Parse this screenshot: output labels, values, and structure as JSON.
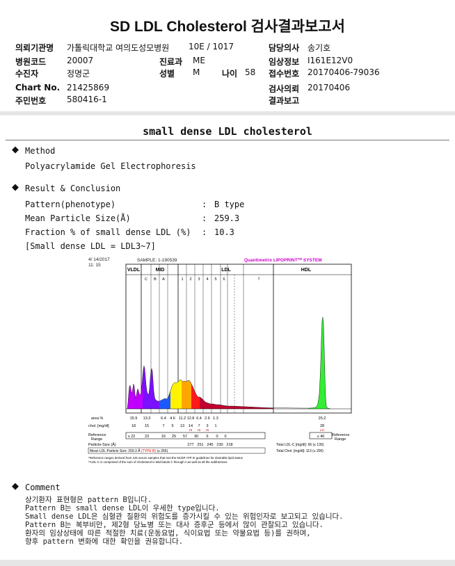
{
  "report_title": "SD LDL Cholesterol 검사결과보고서",
  "header": {
    "institution_label": "의뢰기관명",
    "institution_value": "가톨릭대학교 여의도성모병원",
    "ward_value": "10E / 1017",
    "doctor_label": "담당의사",
    "doctor_value": "송기호",
    "hospital_code_label": "병원코드",
    "hospital_code_value": "20007",
    "dept_label": "진료과",
    "dept_value": "ME",
    "clinical_label": "임상정보",
    "clinical_value": "I161E12V0",
    "patient_label": "수진자",
    "patient_value": "정명군",
    "sex_label": "성별",
    "sex_value": "M",
    "age_label": "나이",
    "age_value": "58",
    "receipt_label": "접수번호",
    "receipt_value": "20170406-79036",
    "chart_label": "Chart No.",
    "chart_value": "21425869",
    "request_label": "검사의뢰",
    "request_value": "20170406",
    "resident_label": "주민번호",
    "resident_value": "580416-1",
    "report_label": "결과보고",
    "report_value": ""
  },
  "section_title": "small dense LDL cholesterol",
  "method": {
    "heading": "Method",
    "text": "Polyacrylamide Gel Electrophoresis"
  },
  "result": {
    "heading": "Result & Conclusion",
    "rows": [
      {
        "label": "Pattern(phenotype)",
        "value": "B type"
      },
      {
        "label": "Mean Particle Size(Å)",
        "value": "259.3"
      },
      {
        "label": "Fraction % of small dense LDL (%)",
        "value": "10.3"
      }
    ],
    "note": "[Small dense LDL = LDL3~7]"
  },
  "chart_panel": {
    "date": "4/ 14/2017",
    "time": "11: 15",
    "sample": "SAMPLE:  1-190539",
    "brand": "Quantimetrix LIPOPRINT",
    "brand_sup": "TM",
    "brand_tail": " SYSTEM",
    "band_groups": [
      "VLDL",
      "MID",
      "LDL",
      "HDL"
    ],
    "mid_bands": [
      "C",
      "B",
      "A"
    ],
    "ldl_bands": [
      "1",
      "2",
      "3",
      "4",
      "5",
      "6",
      "7"
    ],
    "area_label": "area %",
    "area_values": [
      "15.9",
      "13.3",
      "6.4",
      "4.6",
      "11.2",
      "12.8",
      "6.4",
      "2.6",
      "1.3",
      "25.2"
    ],
    "chol_label": "chol. [mg/dl]",
    "chol_values": [
      "18",
      "15",
      "7",
      "5",
      "13",
      "14",
      "7",
      "3",
      "1",
      "28"
    ],
    "flag_values": [
      "HI",
      "HI",
      "HI",
      "LO"
    ],
    "ref_label": "Reference Range",
    "ref_values": [
      "≤ 22",
      "23",
      "15",
      "25",
      "57",
      "30",
      "6",
      "0",
      "0",
      "≥ 40"
    ],
    "particle_label": "Particle-Size (Å)",
    "particle_values": [
      "277",
      "251",
      "245",
      "230",
      "218"
    ],
    "total_ldl_label": "Total LDL-C [mg/dl]:",
    "total_ldl_value": "66",
    "total_ldl_ref": "(≤ 130)",
    "total_chol_label": "Total Chol. [mg/dl]:",
    "total_chol_value": "113",
    "total_chol_ref": "(≤ 200)",
    "mean_ldl_label": "Mean LDL-Particle Size:",
    "mean_ldl_value": "259.3 Å",
    "mean_ldl_type": "(TYPE B)",
    "mean_ldl_ref": "(≥ 265)",
    "footnote1": "*Reference ranges derived from 125 serum samples that met the NCEP ATP III guidelines for desirable lipid status",
    "footnote2": "**LDL-C is comprised of the sum of cholesterol in Mid bands C through A as well as all the subfractions",
    "colors": {
      "vldl": "#c000ff",
      "mid": "#7a10ff",
      "blue": "#1e58ff",
      "yellow": "#fff200",
      "orange": "#ffa500",
      "red": "#ff1a1a",
      "crimson": "#c00030",
      "hdl": "#33ee33",
      "brand": "#cc00cc"
    }
  },
  "comment": {
    "heading": "Comment",
    "lines": [
      "상기환자 표현형은 pattern B입니다.",
      "Pattern B는 small dense LDL이 우세한 type입니다.",
      "Small dense LDL은 심혈관 질환의 위험도를 증가시킬 수 있는 위험인자로 보고되고 있습니다.",
      "Pattern B는 복부비만, 제2형 당뇨병 또는 대사 증후군 등에서 많이 관찰되고 있습니다.",
      "환자의 임상상태에 따른 적절한 치료(운동요법, 식이요법 또는 약물요법 등)를 권하며,",
      "향후 pattern 변화에 대한 확인을 권유합니다."
    ]
  }
}
